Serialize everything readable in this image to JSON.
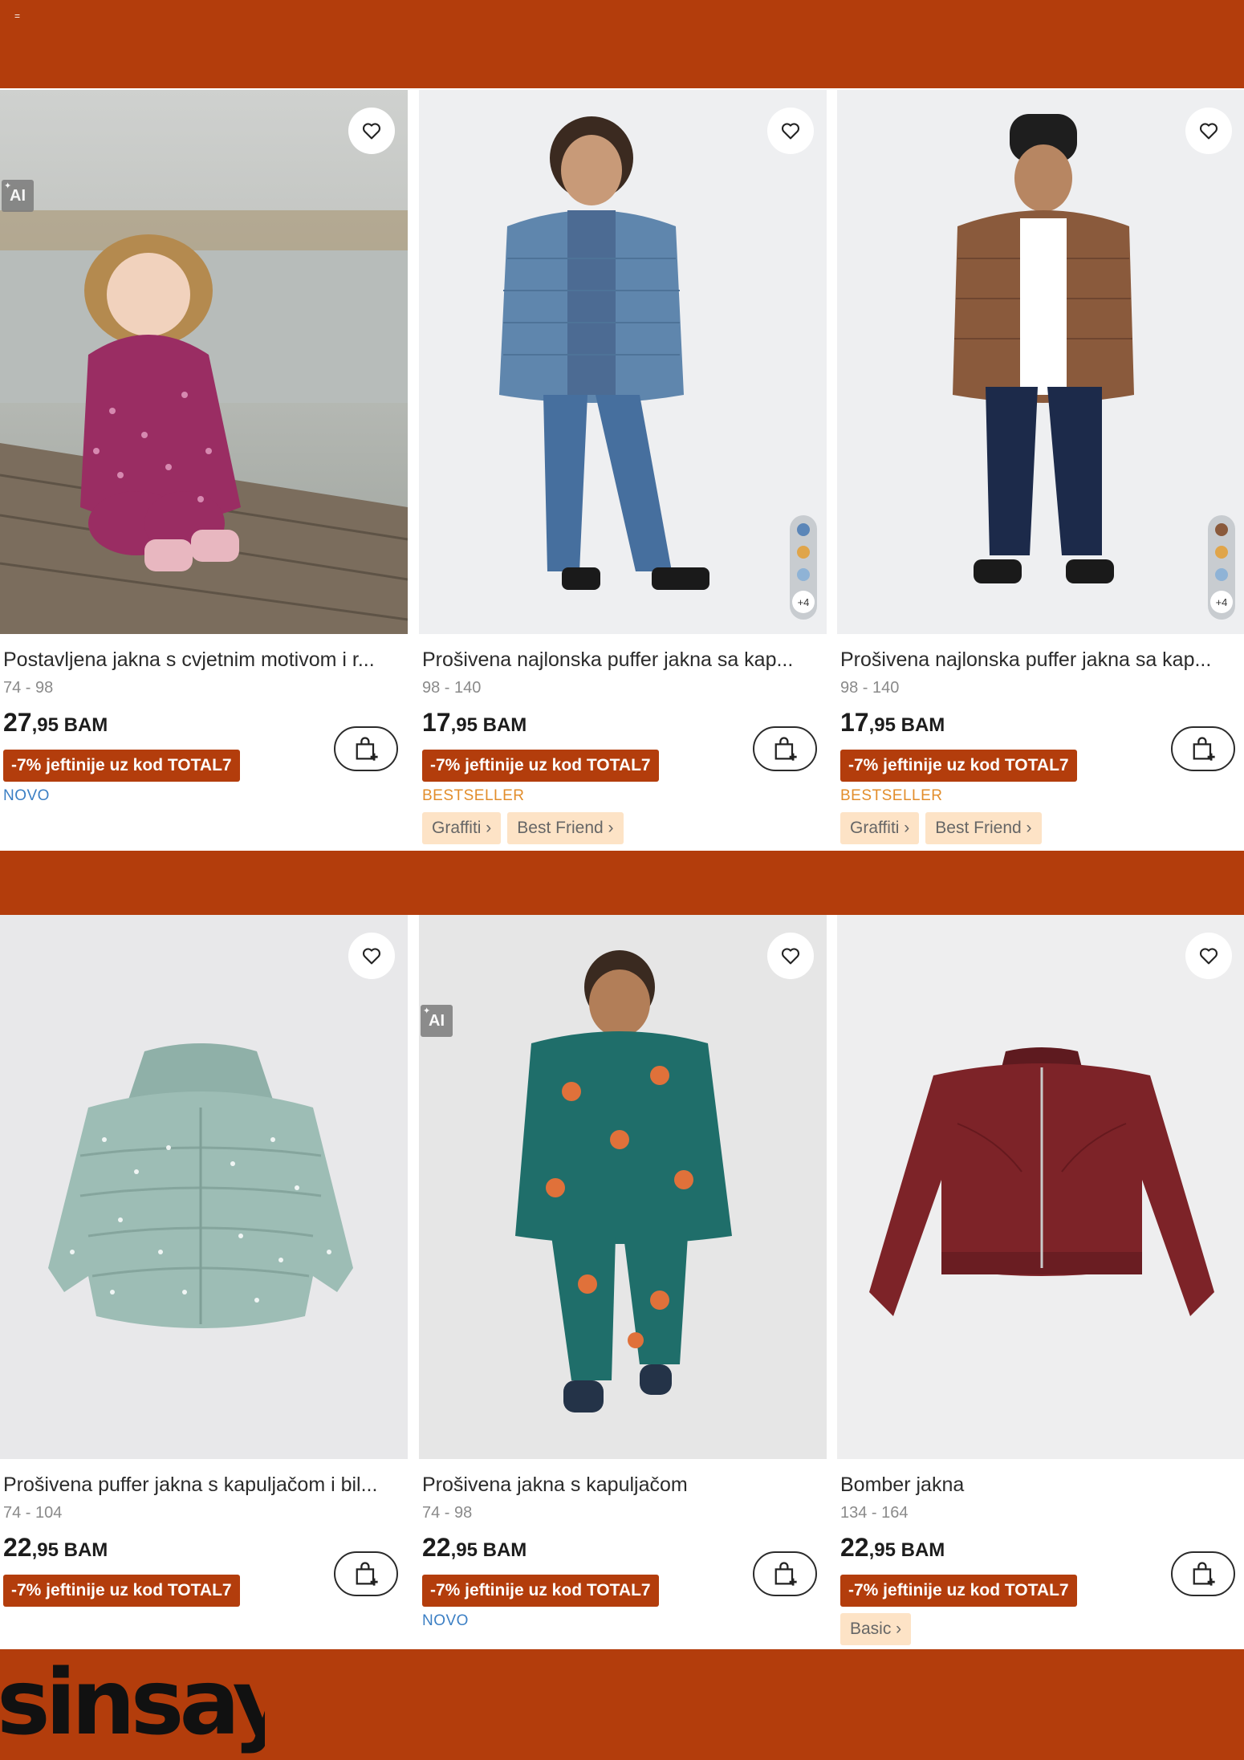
{
  "header": {
    "menu_glyph": "="
  },
  "brand": {
    "logo_text": "sinsay",
    "color": "#b33d0c"
  },
  "products": [
    {
      "title": "Postavljena jakna s cvjetnim motivom i r...",
      "sizes": "74 - 98",
      "price_int": "27",
      "price_dec": ",95",
      "currency": " BAM",
      "promo": "-7% jeftinije uz kod TOTAL7",
      "tag": "NOVO",
      "tag_type": "novo",
      "ai_badge": "AI",
      "chips": []
    },
    {
      "title": "Prošivena najlonska puffer jakna sa kap...",
      "sizes": "98 - 140",
      "price_int": "17",
      "price_dec": ",95",
      "currency": " BAM",
      "promo": "-7% jeftinije uz kod TOTAL7",
      "tag": "BESTSELLER",
      "tag_type": "best",
      "swatches": [
        "#5b86b8",
        "#e0a54a",
        "#8fb3d6"
      ],
      "more_colors": "+4",
      "chips": [
        "Graffiti ›",
        "Best Friend ›"
      ]
    },
    {
      "title": "Prošivena najlonska puffer jakna sa kap...",
      "sizes": "98 - 140",
      "price_int": "17",
      "price_dec": ",95",
      "currency": " BAM",
      "promo": "-7% jeftinije uz kod TOTAL7",
      "tag": "BESTSELLER",
      "tag_type": "best",
      "swatches": [
        "#8a5a3c",
        "#e0a54a",
        "#8fb3d6"
      ],
      "more_colors": "+4",
      "chips": [
        "Graffiti ›",
        "Best Friend ›"
      ]
    },
    {
      "title": "Prošivena puffer jakna s kapuljačom i bil...",
      "sizes": "74 - 104",
      "price_int": "22",
      "price_dec": ",95",
      "currency": " BAM",
      "promo": "-7% jeftinije uz kod TOTAL7",
      "tag": "",
      "chips": []
    },
    {
      "title": "Prošivena jakna s kapuljačom",
      "sizes": "74 - 98",
      "price_int": "22",
      "price_dec": ",95",
      "currency": " BAM",
      "promo": "-7% jeftinije uz kod TOTAL7",
      "tag": "NOVO",
      "tag_type": "novo",
      "ai_badge": "AI",
      "chips": []
    },
    {
      "title": "Bomber jakna",
      "sizes": "134 - 164",
      "price_int": "22",
      "price_dec": ",95",
      "currency": " BAM",
      "promo": "-7% jeftinije uz kod TOTAL7",
      "tag": "",
      "chips": [
        "Basic ›"
      ]
    }
  ]
}
